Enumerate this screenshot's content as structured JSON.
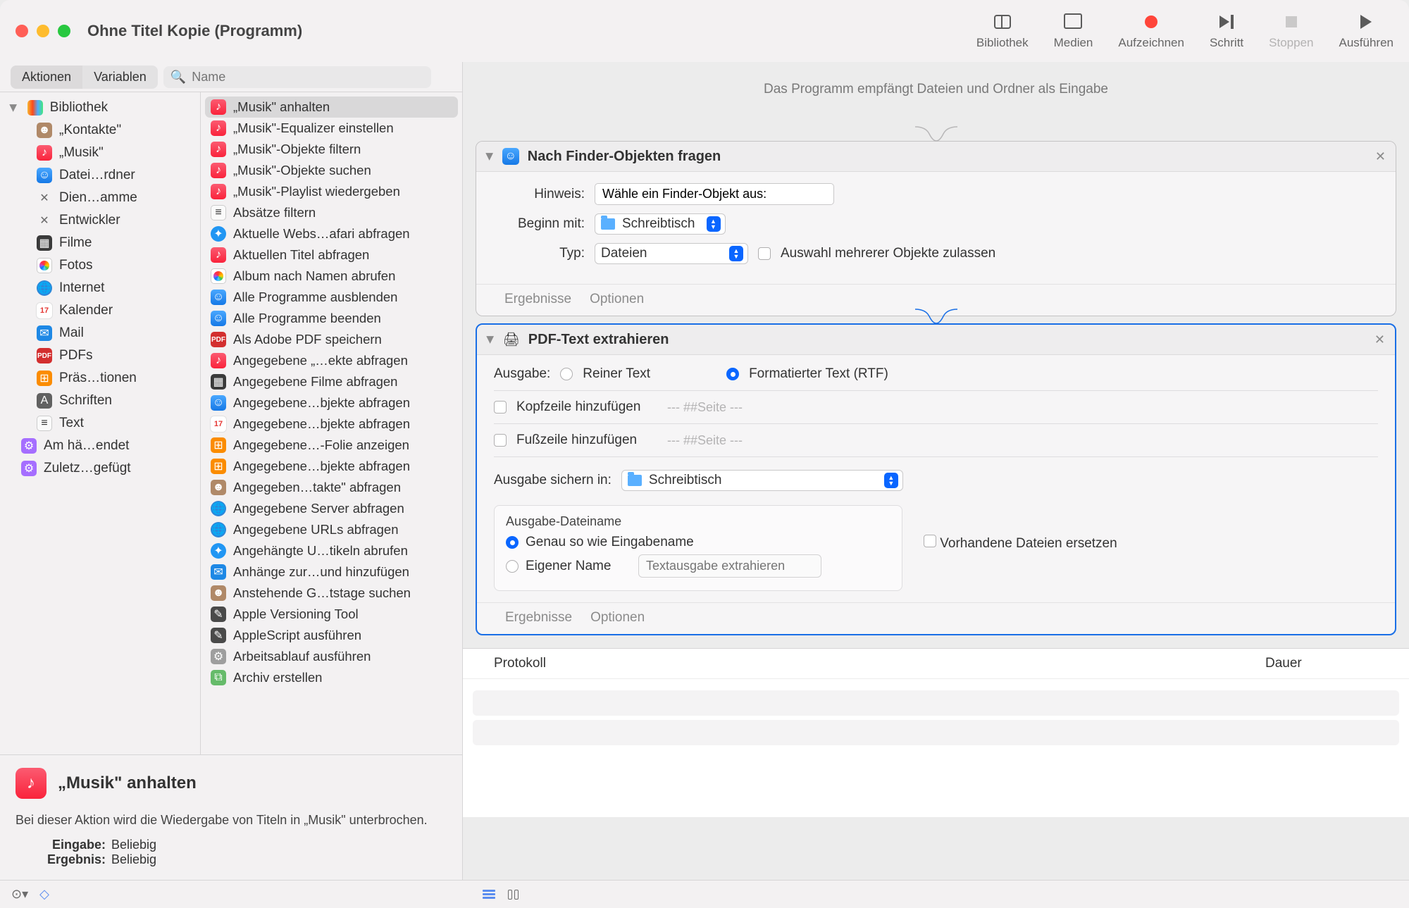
{
  "window": {
    "title": "Ohne Titel Kopie (Programm)"
  },
  "toolbar": {
    "library": "Bibliothek",
    "media": "Medien",
    "record": "Aufzeichnen",
    "step": "Schritt",
    "stop": "Stoppen",
    "run": "Ausführen"
  },
  "segments": {
    "actions": "Aktionen",
    "variables": "Variablen",
    "search_placeholder": "Name"
  },
  "library": {
    "root": "Bibliothek",
    "categories": [
      {
        "icon": "contacts",
        "label": "„Kontakte\""
      },
      {
        "icon": "music",
        "label": "„Musik\""
      },
      {
        "icon": "finder",
        "label": "Datei…rdner"
      },
      {
        "icon": "tools",
        "label": "Dien…amme"
      },
      {
        "icon": "tools",
        "label": "Entwickler"
      },
      {
        "icon": "film",
        "label": "Filme"
      },
      {
        "icon": "photos",
        "label": "Fotos"
      },
      {
        "icon": "globe",
        "label": "Internet"
      },
      {
        "icon": "cal",
        "label": "Kalender"
      },
      {
        "icon": "mail",
        "label": "Mail"
      },
      {
        "icon": "pdf",
        "label": "PDFs"
      },
      {
        "icon": "key",
        "label": "Präs…tionen"
      },
      {
        "icon": "font",
        "label": "Schriften"
      },
      {
        "icon": "txt",
        "label": "Text"
      }
    ],
    "smart": [
      {
        "icon": "folder",
        "label": "Am hä…endet"
      },
      {
        "icon": "folder",
        "label": "Zuletz…gefügt"
      }
    ]
  },
  "actions": [
    {
      "icon": "music",
      "label": "„Musik\" anhalten",
      "selected": true
    },
    {
      "icon": "music",
      "label": "„Musik\"-Equalizer einstellen"
    },
    {
      "icon": "music",
      "label": "„Musik\"-Objekte filtern"
    },
    {
      "icon": "music",
      "label": "„Musik\"-Objekte suchen"
    },
    {
      "icon": "music",
      "label": "„Musik\"-Playlist wiedergeben"
    },
    {
      "icon": "txt",
      "label": "Absätze filtern"
    },
    {
      "icon": "safari",
      "label": "Aktuelle Webs…afari abfragen"
    },
    {
      "icon": "music",
      "label": "Aktuellen Titel abfragen"
    },
    {
      "icon": "photos",
      "label": "Album nach Namen abrufen"
    },
    {
      "icon": "finder",
      "label": "Alle Programme ausblenden"
    },
    {
      "icon": "finder",
      "label": "Alle Programme beenden"
    },
    {
      "icon": "pdf",
      "label": "Als Adobe PDF speichern"
    },
    {
      "icon": "music",
      "label": "Angegebene „…ekte abfragen"
    },
    {
      "icon": "film",
      "label": "Angegebene Filme abfragen"
    },
    {
      "icon": "finder",
      "label": "Angegebene…bjekte abfragen"
    },
    {
      "icon": "cal",
      "label": "Angegebene…bjekte abfragen"
    },
    {
      "icon": "key",
      "label": "Angegebene…-Folie anzeigen"
    },
    {
      "icon": "key",
      "label": "Angegebene…bjekte abfragen"
    },
    {
      "icon": "contacts",
      "label": "Angegeben…takte\" abfragen"
    },
    {
      "icon": "globe",
      "label": "Angegebene Server abfragen"
    },
    {
      "icon": "globe",
      "label": "Angegebene URLs abfragen"
    },
    {
      "icon": "safari",
      "label": "Angehängte U…tikeln abrufen"
    },
    {
      "icon": "mail",
      "label": "Anhänge zur…und hinzufügen"
    },
    {
      "icon": "contacts",
      "label": "Anstehende G…tstage suchen"
    },
    {
      "icon": "script",
      "label": "Apple Versioning Tool"
    },
    {
      "icon": "script",
      "label": "AppleScript ausführen"
    },
    {
      "icon": "auto",
      "label": "Arbeitsablauf ausführen"
    },
    {
      "icon": "archive",
      "label": "Archiv erstellen"
    }
  ],
  "info": {
    "title": "„Musik\" anhalten",
    "desc": "Bei dieser Aktion wird die Wiedergabe von Titeln in „Musik\" unterbrochen.",
    "input_label": "Eingabe:",
    "input_value": "Beliebig",
    "output_label": "Ergebnis:",
    "output_value": "Beliebig"
  },
  "workflow": {
    "input_desc": "Das Programm empfängt Dateien und Ordner als Eingabe",
    "results_label": "Ergebnisse",
    "options_label": "Optionen",
    "card1": {
      "title": "Nach Finder-Objekten fragen",
      "hint_label": "Hinweis:",
      "hint_value": "Wähle ein Finder-Objekt aus:",
      "start_label": "Beginn mit:",
      "start_value": "Schreibtisch",
      "type_label": "Typ:",
      "type_value": "Dateien",
      "multi_label": "Auswahl mehrerer Objekte zulassen"
    },
    "card2": {
      "title": "PDF-Text extrahieren",
      "output_label": "Ausgabe:",
      "opt_plain": "Reiner Text",
      "opt_rtf": "Formatierter Text (RTF)",
      "header_label": "Kopfzeile hinzufügen",
      "header_ph": "--- ##Seite ---",
      "footer_label": "Fußzeile hinzufügen",
      "footer_ph": "--- ##Seite ---",
      "save_label": "Ausgabe sichern in:",
      "save_value": "Schreibtisch",
      "fname_group": "Ausgabe-Dateiname",
      "fname_same": "Genau so wie Eingabename",
      "fname_custom": "Eigener Name",
      "fname_ph": "Textausgabe extrahieren",
      "replace_label": "Vorhandene Dateien ersetzen"
    }
  },
  "log": {
    "col1": "Protokoll",
    "col2": "Dauer"
  }
}
